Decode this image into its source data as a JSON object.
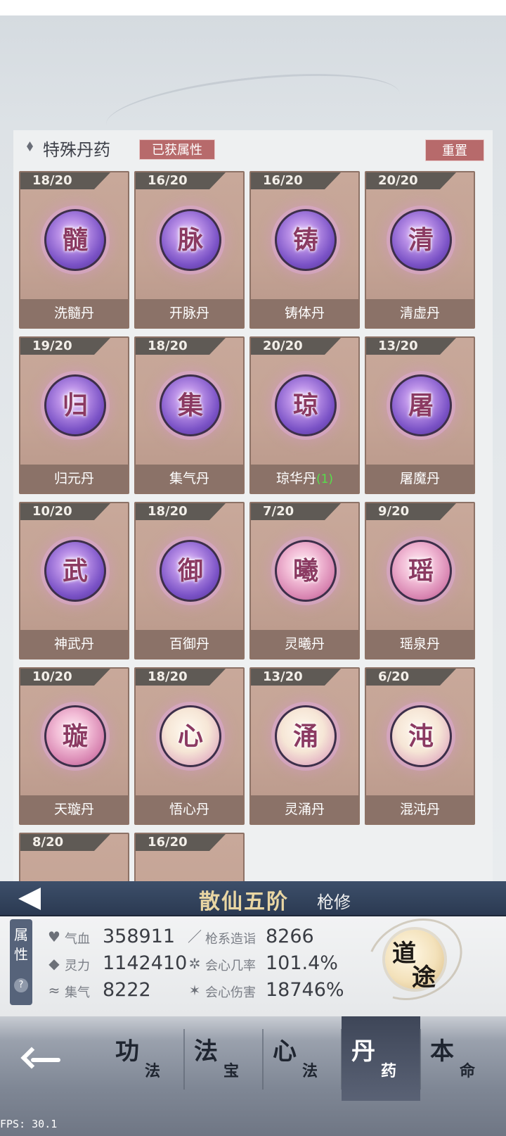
{
  "panel": {
    "title": "特殊丹药",
    "tag_label": "已获属性",
    "reset_label": "重置"
  },
  "pills": [
    {
      "count": "18/20",
      "char": "髓",
      "name": "洗髓丹",
      "extra": "",
      "orb": "purple"
    },
    {
      "count": "16/20",
      "char": "脉",
      "name": "开脉丹",
      "extra": "",
      "orb": "purple"
    },
    {
      "count": "16/20",
      "char": "铸",
      "name": "铸体丹",
      "extra": "",
      "orb": "purple"
    },
    {
      "count": "20/20",
      "char": "清",
      "name": "清虚丹",
      "extra": "",
      "orb": "purple"
    },
    {
      "count": "19/20",
      "char": "归",
      "name": "归元丹",
      "extra": "",
      "orb": "purple"
    },
    {
      "count": "18/20",
      "char": "集",
      "name": "集气丹",
      "extra": "",
      "orb": "purple"
    },
    {
      "count": "20/20",
      "char": "琼",
      "name": "琼华丹",
      "extra": "(1)",
      "orb": "purple"
    },
    {
      "count": "13/20",
      "char": "屠",
      "name": "屠魔丹",
      "extra": "",
      "orb": "purple"
    },
    {
      "count": "10/20",
      "char": "武",
      "name": "神武丹",
      "extra": "",
      "orb": "purple"
    },
    {
      "count": "18/20",
      "char": "御",
      "name": "百御丹",
      "extra": "",
      "orb": "purple"
    },
    {
      "count": "7/20",
      "char": "曦",
      "name": "灵曦丹",
      "extra": "",
      "orb": "pink"
    },
    {
      "count": "9/20",
      "char": "瑶",
      "name": "瑶泉丹",
      "extra": "",
      "orb": "pink"
    },
    {
      "count": "10/20",
      "char": "璇",
      "name": "天璇丹",
      "extra": "",
      "orb": "pink"
    },
    {
      "count": "18/20",
      "char": "心",
      "name": "悟心丹",
      "extra": "",
      "orb": "gold"
    },
    {
      "count": "13/20",
      "char": "涌",
      "name": "灵涌丹",
      "extra": "",
      "orb": "gold"
    },
    {
      "count": "6/20",
      "char": "沌",
      "name": "混沌丹",
      "extra": "",
      "orb": "gold"
    },
    {
      "count": "8/20",
      "char": "",
      "name": "",
      "extra": "",
      "orb": "none"
    },
    {
      "count": "16/20",
      "char": "",
      "name": "",
      "extra": "",
      "orb": "none"
    }
  ],
  "status": {
    "realm": "散仙五阶",
    "class": "枪修"
  },
  "attributes": {
    "tab_label_1": "属",
    "tab_label_2": "性",
    "help": "?",
    "stats": [
      {
        "icon": "heart-icon",
        "glyph": "♥",
        "label": "气血",
        "value": "358911"
      },
      {
        "icon": "spear-icon",
        "glyph": "／",
        "label": "枪系造诣",
        "value": "8266"
      },
      {
        "icon": "drop-icon",
        "glyph": "◆",
        "label": "灵力",
        "value": "1142410"
      },
      {
        "icon": "crit-icon",
        "glyph": "✲",
        "label": "会心几率",
        "value": "101.4%"
      },
      {
        "icon": "swirl-icon",
        "glyph": "≈",
        "label": "集气",
        "value": "8222"
      },
      {
        "icon": "burst-icon",
        "glyph": "✶",
        "label": "会心伤害",
        "value": "18746%"
      }
    ]
  },
  "dao": {
    "char1": "道",
    "char2": "途"
  },
  "nav": {
    "tabs": [
      {
        "big": "功",
        "small": "法",
        "active": false
      },
      {
        "big": "法",
        "small": "宝",
        "active": false
      },
      {
        "big": "心",
        "small": "法",
        "active": false
      },
      {
        "big": "丹",
        "small": "药",
        "active": true
      },
      {
        "big": "本",
        "small": "命",
        "active": false
      }
    ]
  },
  "fps": "FPS: 30.1"
}
